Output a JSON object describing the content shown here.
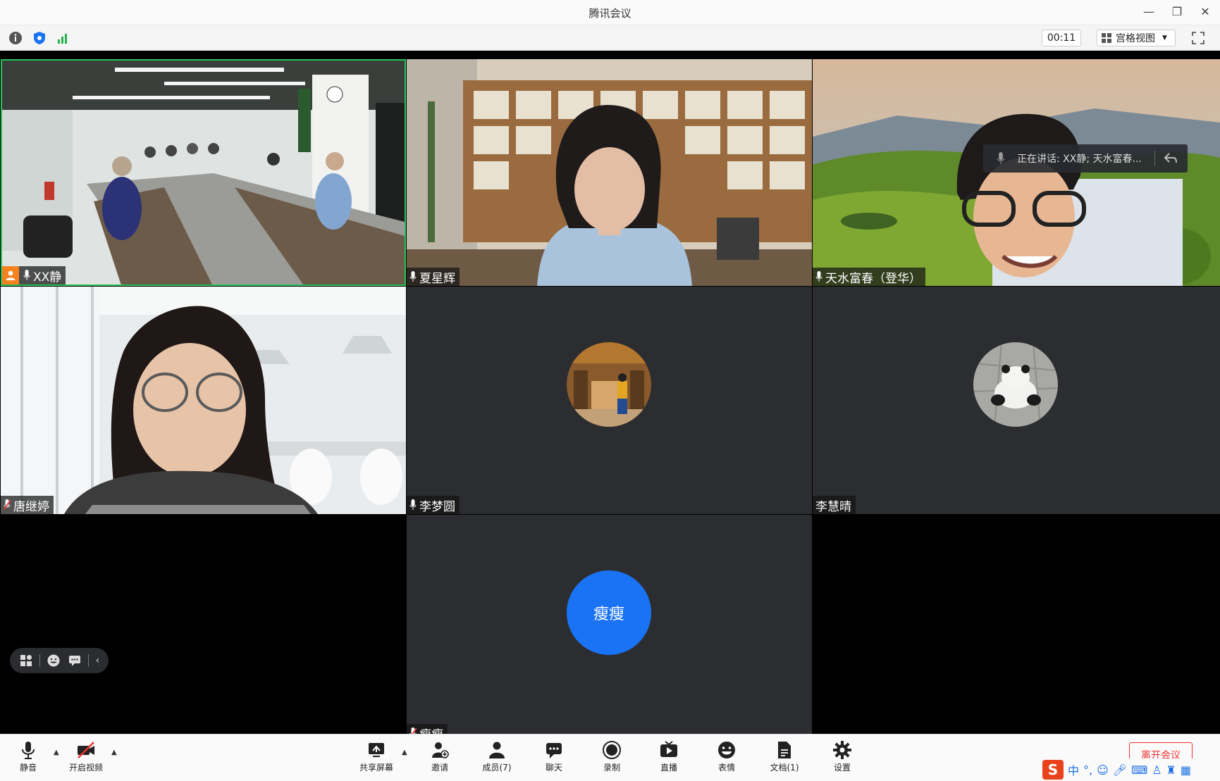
{
  "window": {
    "title": "腾讯会议",
    "minimize_icon": "minimize-icon",
    "restore_icon": "restore-icon",
    "close_icon": "close-icon"
  },
  "infobar": {
    "timer": "00:11",
    "view_mode": "宫格视图",
    "icons": [
      "info-icon",
      "shield-icon",
      "signal-icon",
      "fullscreen-icon"
    ]
  },
  "tiles": [
    {
      "name": "XX静",
      "kind": "video",
      "host": true,
      "mic": "on"
    },
    {
      "name": "夏星辉",
      "kind": "video",
      "mic": "on"
    },
    {
      "name": "天水富春（登华）",
      "kind": "video",
      "mic": "on"
    },
    {
      "name": "唐继婷",
      "kind": "video",
      "mic": "muted"
    },
    {
      "name": "李梦圆",
      "kind": "avatar",
      "mic": "on"
    },
    {
      "name": "李慧晴",
      "kind": "avatar",
      "mic": "none"
    },
    {
      "name": "瘦瘦",
      "kind": "initials",
      "initials": "瘦瘦",
      "mic": "muted"
    }
  ],
  "speaking_indicator": {
    "text": "正在讲话: XX静; 天水富春..."
  },
  "toolbar": {
    "items": [
      {
        "label": "静音",
        "icon": "microphone-icon"
      },
      {
        "label": "开启视频",
        "icon": "camera-off-icon"
      },
      {
        "label": "共享屏幕",
        "icon": "share-screen-icon"
      },
      {
        "label": "邀请",
        "icon": "invite-icon"
      },
      {
        "label": "成员(7)",
        "icon": "members-icon"
      },
      {
        "label": "聊天",
        "icon": "chat-icon"
      },
      {
        "label": "录制",
        "icon": "record-icon"
      },
      {
        "label": "直播",
        "icon": "live-icon"
      },
      {
        "label": "表情",
        "icon": "emoji-icon"
      },
      {
        "label": "文档(1)",
        "icon": "document-icon"
      },
      {
        "label": "设置",
        "icon": "settings-icon"
      }
    ],
    "leave": "离开会议"
  },
  "ime": {
    "logo": "S",
    "mode": "中"
  },
  "colors": {
    "accent": "#1a73f4",
    "host_badge": "#f5811f",
    "leave": "#e33333"
  }
}
